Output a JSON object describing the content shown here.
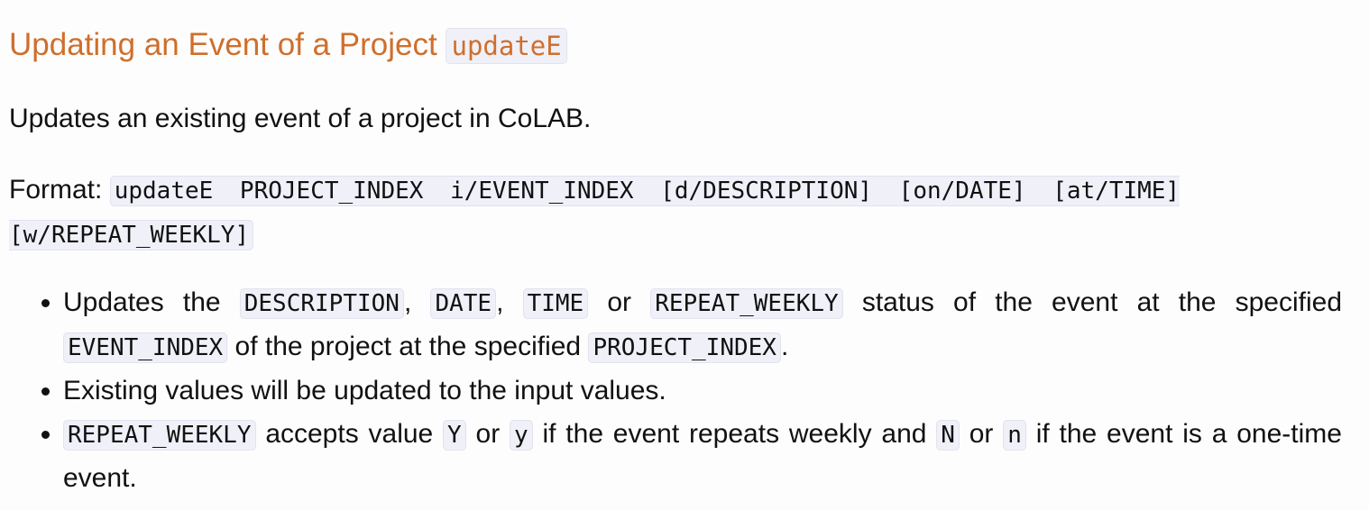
{
  "heading": {
    "text": "Updating an Event of a Project",
    "code": "updateE"
  },
  "description": "Updates an existing event of a project in CoLAB.",
  "format": {
    "label": "Format:",
    "command": "updateE PROJECT_INDEX i/EVENT_INDEX [d/DESCRIPTION] [on/DATE] [at/TIME] [w/REPEAT_WEEKLY]"
  },
  "bullets": [
    {
      "t1": "Updates the",
      "c1": "DESCRIPTION",
      "t2": ",",
      "c2": "DATE",
      "t3": ",",
      "c3": "TIME",
      "t4": "or",
      "c4": "REPEAT_WEEKLY",
      "t5": "status of the event at the specified",
      "c5": "EVENT_INDEX",
      "t6": "of the project at the specified",
      "c6": "PROJECT_INDEX",
      "t7": "."
    },
    {
      "text": "Existing values will be updated to the input values."
    },
    {
      "c1": "REPEAT_WEEKLY",
      "t1": "accepts value",
      "c2": "Y",
      "t2": "or",
      "c3": "y",
      "t3": "if the event repeats weekly and",
      "c4": "N",
      "t4": "or",
      "c5": "n",
      "t5": "if the event is a one-time event."
    }
  ],
  "colors": {
    "heading": "#cf6f2b",
    "code_background": "#f0f0f9",
    "text": "#111111"
  }
}
